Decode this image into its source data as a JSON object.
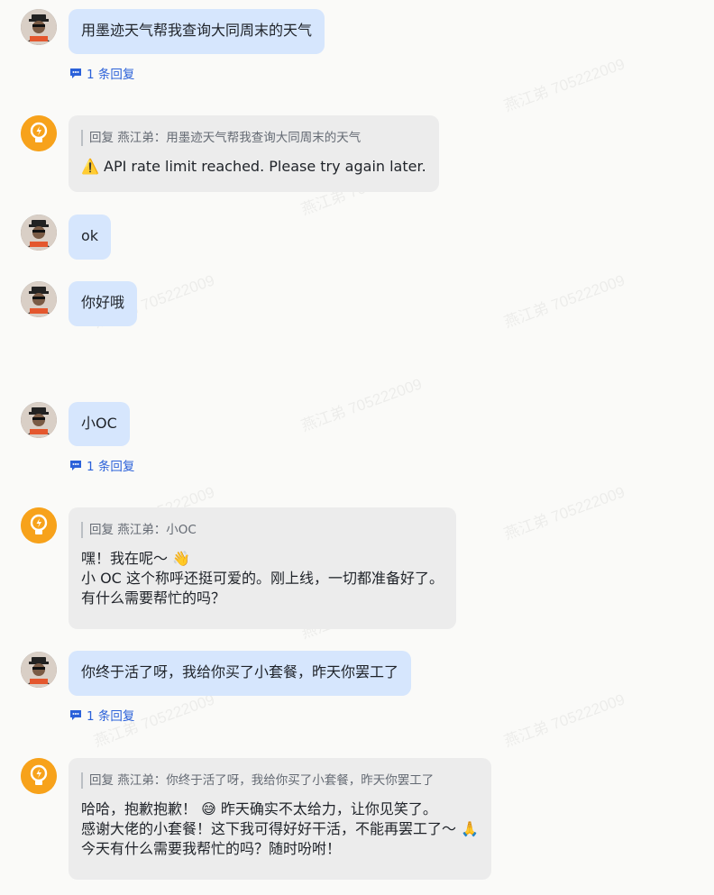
{
  "watermark": "燕江弟 705222009",
  "messages": [
    {
      "type": "user",
      "text": "用墨迹天气帮我查询大同周末的天气",
      "reply_count": "1 条回复"
    },
    {
      "type": "bot",
      "quote": "回复 燕江弟：用墨迹天气帮我查询大同周末的天气",
      "lines": [
        "⚠️ API rate limit reached. Please try again later."
      ]
    },
    {
      "type": "user",
      "text": "ok"
    },
    {
      "type": "user",
      "text": "你好哦"
    },
    {
      "type": "user",
      "text": "小OC",
      "reply_count": "1 条回复"
    },
    {
      "type": "bot",
      "quote": "回复 燕江弟：小OC",
      "lines": [
        "嘿！我在呢～ 👋",
        "小 OC 这个称呼还挺可爱的。刚上线，一切都准备好了。",
        "有什么需要帮忙的吗？"
      ]
    },
    {
      "type": "user",
      "text": "你终于活了呀，我给你买了小套餐，昨天你罢工了",
      "reply_count": "1 条回复"
    },
    {
      "type": "bot",
      "quote": "回复 燕江弟：你终于活了呀，我给你买了小套餐，昨天你罢工了",
      "lines": [
        "哈哈，抱歉抱歉！ 😅 昨天确实不太给力，让你见笑了。",
        "感谢大佬的小套餐！这下我可得好好干活，不能再罢工了～ 🙏",
        "今天有什么需要我帮忙的吗？随时吩咐！"
      ]
    }
  ],
  "colors": {
    "user_bubble": "#d6e6fd",
    "bot_bubble": "#ececec",
    "link": "#2b61d9",
    "bot_avatar": "#f7a21b"
  }
}
